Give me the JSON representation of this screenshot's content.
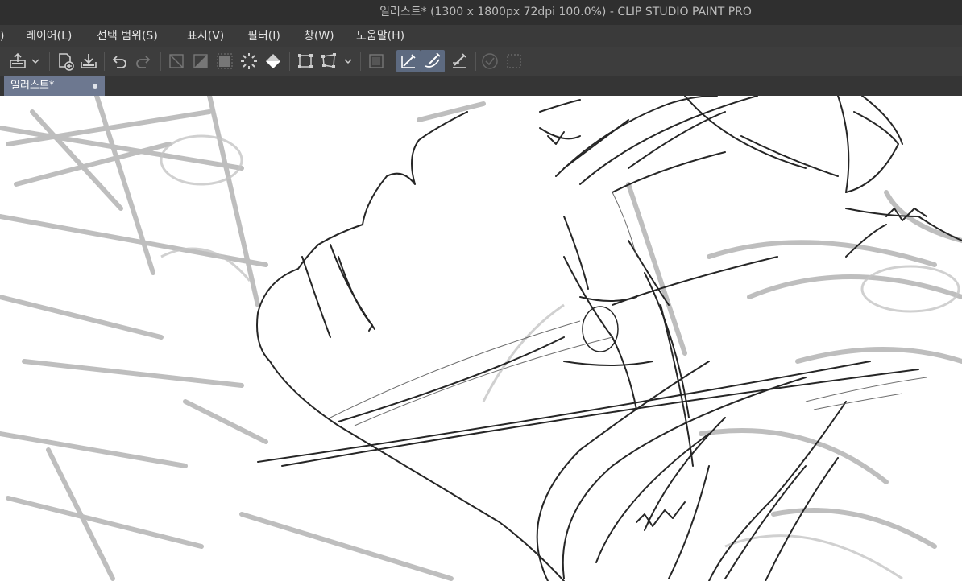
{
  "window": {
    "title": "일러스트* (1300 x 1800px 72dpi 100.0%)  - CLIP STUDIO PAINT PRO"
  },
  "menu": {
    "items": [
      {
        "label": ")"
      },
      {
        "label": "레이어(L)"
      },
      {
        "label": "선택 범위(S)"
      },
      {
        "label": "표시(V)"
      },
      {
        "label": "필터(I)"
      },
      {
        "label": "창(W)"
      },
      {
        "label": "도움말(H)"
      }
    ]
  },
  "toolbar": {
    "buttons": [
      {
        "icon": "layer-property-icon"
      },
      {
        "icon": "chevron-down-icon"
      },
      {
        "icon": "new-file-icon"
      },
      {
        "icon": "save-icon"
      },
      {
        "icon": "undo-icon"
      },
      {
        "icon": "redo-icon"
      },
      {
        "icon": "clear-layer-icon"
      },
      {
        "icon": "clear-outside-selection-icon"
      },
      {
        "icon": "fill-icon"
      },
      {
        "icon": "expand-selection-icon"
      },
      {
        "icon": "fill-bucket-icon"
      },
      {
        "icon": "transform-icon"
      },
      {
        "icon": "free-transform-icon"
      },
      {
        "icon": "chevron-down-icon"
      },
      {
        "icon": "show-selection-icon"
      },
      {
        "icon": "snap-to-ruler-icon",
        "active": true
      },
      {
        "icon": "snap-to-special-ruler-icon",
        "active": true
      },
      {
        "icon": "snap-to-grid-icon"
      },
      {
        "icon": "confirm-icon"
      },
      {
        "icon": "selection-border-icon"
      }
    ]
  },
  "tabs": [
    {
      "label": "일러스트*",
      "modified": true,
      "active": true
    }
  ],
  "canvas": {
    "content": "sketch-layer"
  },
  "colors": {
    "titlebar": "#2f2f2f",
    "menubar": "#3a3a3a",
    "toolbar": "#3d3d3d",
    "active_tab": "#6d7890",
    "active_tool": "#5d6a80",
    "canvas": "#ffffff"
  }
}
